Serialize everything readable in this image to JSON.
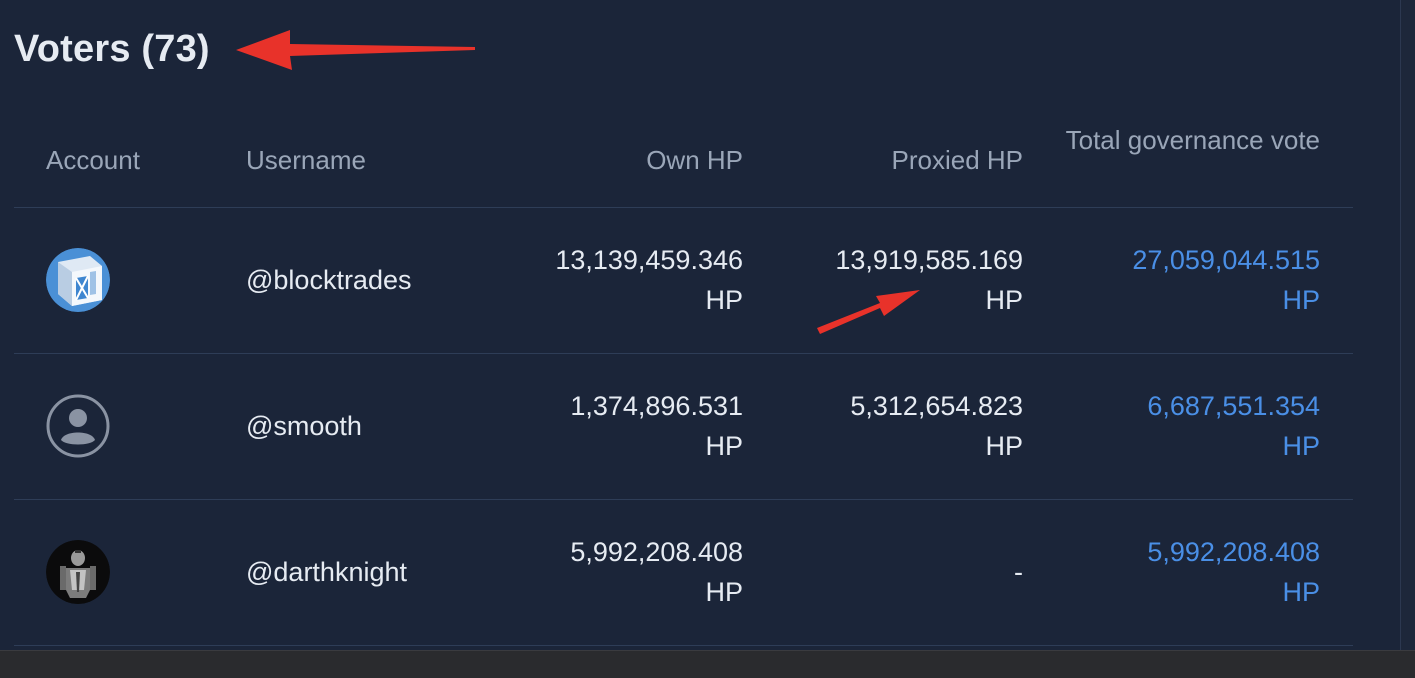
{
  "title": "Voters (73)",
  "columns": {
    "account": "Account",
    "username": "Username",
    "own_hp": "Own HP",
    "proxied_hp": "Proxied HP",
    "total_governance_vote": "Total governance vote"
  },
  "unit": "HP",
  "rows": [
    {
      "username": "@blocktrades",
      "avatar_icon": "blocktrades-logo-icon",
      "own_hp": "13,139,459.346",
      "proxied_hp": "13,919,585.169",
      "total": "27,059,044.515"
    },
    {
      "username": "@smooth",
      "avatar_icon": "default-user-icon",
      "own_hp": "1,374,896.531",
      "proxied_hp": "5,312,654.823",
      "total": "6,687,551.354"
    },
    {
      "username": "@darthknight",
      "avatar_icon": "knight-avatar-icon",
      "own_hp": "5,992,208.408",
      "proxied_hp": "-",
      "total": "5,992,208.408"
    }
  ],
  "colors": {
    "background": "#1b2539",
    "text": "#e6ebf2",
    "muted": "#9aa6b8",
    "link": "#4a8fe6",
    "annotation_arrow": "#e8322a"
  }
}
